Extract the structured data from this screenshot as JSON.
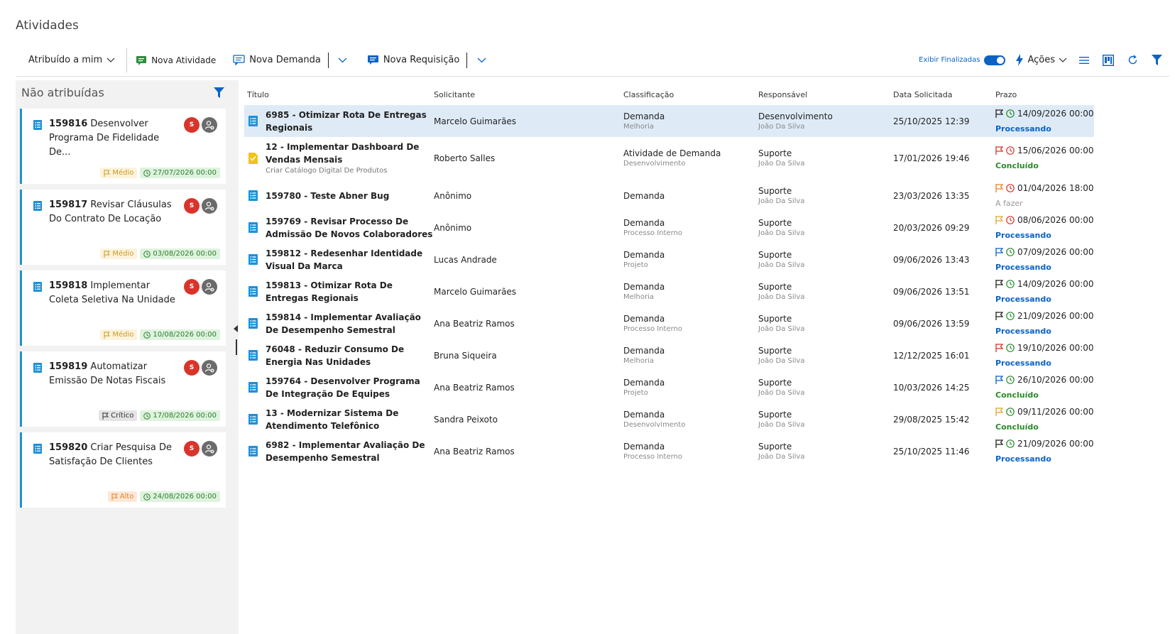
{
  "page_title": "Atividades",
  "toolbar": {
    "assigned": "Atribuído a mim",
    "nova_atividade": "Nova Atividade",
    "nova_demanda": "Nova Demanda",
    "nova_requisicao": "Nova Requisição",
    "exibir_finalizadas": "Exibir Finalizadas",
    "acoes": "Ações"
  },
  "left_panel": {
    "title": "Não atribuídas",
    "cards": [
      {
        "id": "159816",
        "title": "Desenvolver Programa De Fidelidade De...",
        "avatar": "S",
        "priority": "Médio",
        "date": "27/07/2026 00:00"
      },
      {
        "id": "159817",
        "title": "Revisar Cláusulas Do Contrato De Locação",
        "avatar": "S",
        "priority": "Médio",
        "date": "03/08/2026 00:00"
      },
      {
        "id": "159818",
        "title": "Implementar Coleta Seletiva Na Unidade",
        "avatar": "S",
        "priority": "Médio",
        "date": "10/08/2026 00:00"
      },
      {
        "id": "159819",
        "title": "Automatizar Emissão De Notas Fiscais",
        "avatar": "S",
        "priority": "Crítico",
        "date": "17/08/2026 00:00"
      },
      {
        "id": "159820",
        "title": "Criar Pesquisa De Satisfação De Clientes",
        "avatar": "S",
        "priority": "Alto",
        "date": "24/08/2026 00:00"
      }
    ]
  },
  "table": {
    "headers": {
      "title": "Título",
      "requester": "Solicitante",
      "classification": "Classificação",
      "responsible": "Responsável",
      "date": "Data Solicitada",
      "deadline": "Prazo"
    },
    "rows": [
      {
        "title": "6985 - Otimizar Rota De Entregas Regionais",
        "sub": "",
        "requester": "Marcelo Guimarães",
        "class": "Demanda",
        "class_sub": "Melhoria",
        "resp": "Desenvolvimento",
        "resp_sub": "João Da Silva",
        "date": "25/10/2025 12:39",
        "deadline": "14/09/2026 00:00",
        "status": "Processando"
      },
      {
        "title": "12 - Implementar Dashboard De Vendas Mensais",
        "sub": "Criar Catálogo Digital De Produtos",
        "requester": "Roberto Salles",
        "class": "Atividade de Demanda",
        "class_sub": "Desenvolvimento",
        "resp": "Suporte",
        "resp_sub": "João Da Silva",
        "date": "17/01/2026 19:46",
        "deadline": "15/06/2026 00:00",
        "status": "Concluído"
      },
      {
        "title": "159780 - Teste Abner Bug",
        "sub": "",
        "requester": "Anônimo",
        "class": "Demanda",
        "class_sub": "",
        "resp": "Suporte",
        "resp_sub": "João Da Silva",
        "date": "23/03/2026 13:35",
        "deadline": "01/04/2026 18:00",
        "status": "A fazer"
      },
      {
        "title": "159769 - Revisar Processo De Admissão De Novos Colaboradores",
        "sub": "",
        "requester": "Anônimo",
        "class": "Demanda",
        "class_sub": "Processo Interno",
        "resp": "Suporte",
        "resp_sub": "João Da Silva",
        "date": "20/03/2026 09:29",
        "deadline": "08/06/2026 00:00",
        "status": "Processando"
      },
      {
        "title": "159812 - Redesenhar Identidade Visual Da Marca",
        "sub": "",
        "requester": "Lucas Andrade",
        "class": "Demanda",
        "class_sub": "Projeto",
        "resp": "Suporte",
        "resp_sub": "João Da Silva",
        "date": "09/06/2026 13:43",
        "deadline": "07/09/2026 00:00",
        "status": "Processando"
      },
      {
        "title": "159813 - Otimizar Rota De Entregas Regionais",
        "sub": "",
        "requester": "Marcelo Guimarães",
        "class": "Demanda",
        "class_sub": "Melhoria",
        "resp": "Suporte",
        "resp_sub": "João Da Silva",
        "date": "09/06/2026 13:51",
        "deadline": "14/09/2026 00:00",
        "status": "Processando"
      },
      {
        "title": "159814 - Implementar Avaliação De Desempenho Semestral",
        "sub": "",
        "requester": "Ana Beatriz Ramos",
        "class": "Demanda",
        "class_sub": "Processo Interno",
        "resp": "Suporte",
        "resp_sub": "João Da Silva",
        "date": "09/06/2026 13:59",
        "deadline": "21/09/2026 00:00",
        "status": "Processando"
      },
      {
        "title": "76048 - Reduzir Consumo De Energia Nas Unidades",
        "sub": "",
        "requester": "Bruna Siqueira",
        "class": "Demanda",
        "class_sub": "Melhoria",
        "resp": "Suporte",
        "resp_sub": "João Da Silva",
        "date": "12/12/2025 16:01",
        "deadline": "19/10/2026 00:00",
        "status": "Processando"
      },
      {
        "title": "159764 - Desenvolver Programa De Integração De Equipes",
        "sub": "",
        "requester": "Ana Beatriz Ramos",
        "class": "Demanda",
        "class_sub": "Projeto",
        "resp": "Suporte",
        "resp_sub": "João Da Silva",
        "date": "10/03/2026 14:25",
        "deadline": "26/10/2026 00:00",
        "status": "Concluído"
      },
      {
        "title": "13 - Modernizar Sistema De Atendimento Telefônico",
        "sub": "",
        "requester": "Sandra Peixoto",
        "class": "Demanda",
        "class_sub": "Desenvolvimento",
        "resp": "Suporte",
        "resp_sub": "João Da Silva",
        "date": "29/08/2025 15:42",
        "deadline": "09/11/2026 00:00",
        "status": "Concluído"
      },
      {
        "title": "6982 - Implementar Avaliação De Desempenho Semestral",
        "sub": "",
        "requester": "Ana Beatriz Ramos",
        "class": "Demanda",
        "class_sub": "Processo Interno",
        "resp": "Suporte",
        "resp_sub": "João Da Silva",
        "date": "25/10/2025 11:46",
        "deadline": "21/09/2026 00:00",
        "status": "Processando"
      }
    ]
  },
  "colors": {
    "accent": "#0b63c4",
    "selected_row": "#deebf7",
    "card_border": "#1e90d6",
    "avatar_red": "#d9342b"
  }
}
